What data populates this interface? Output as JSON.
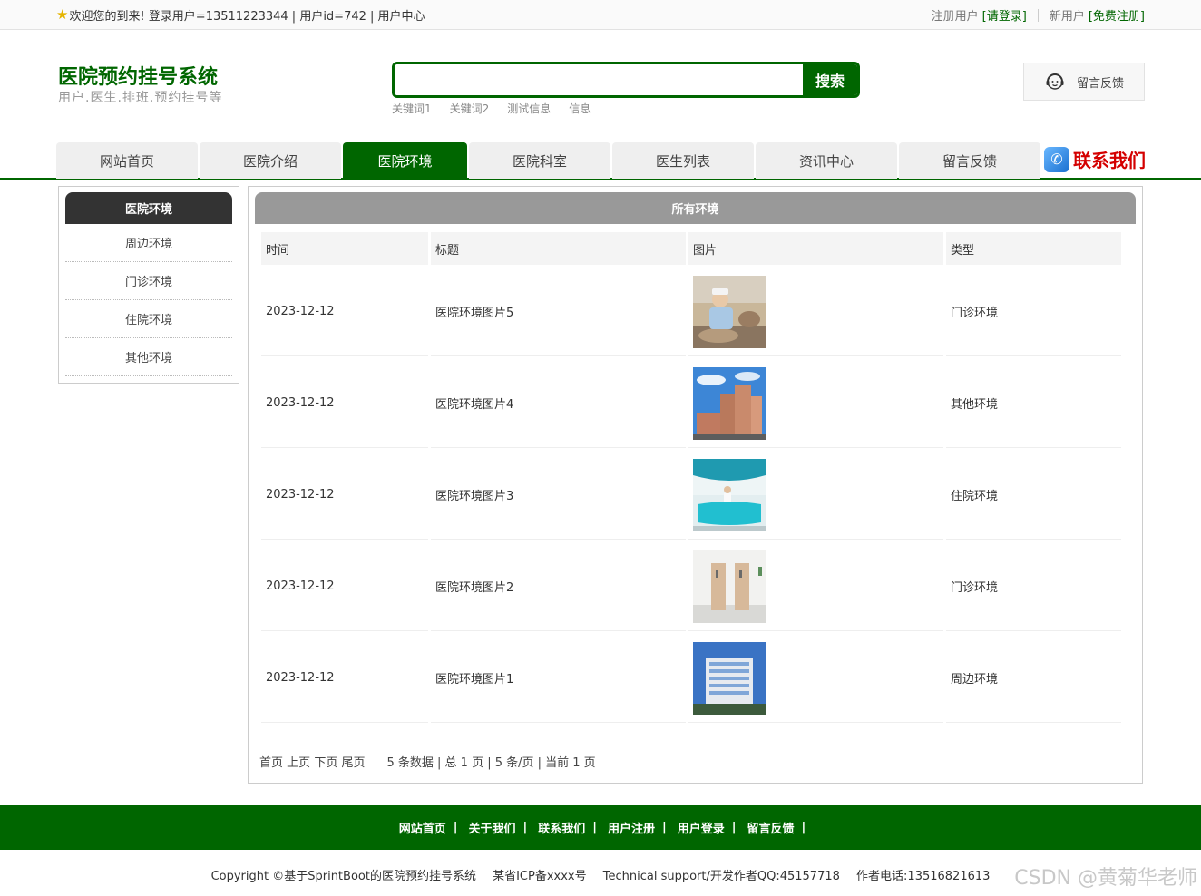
{
  "topbar": {
    "welcome": "欢迎您的到来!  登录用户=13511223344 | 用户id=742 | 用户中心",
    "registered_label": "注册用户",
    "login_link": "[请登录]",
    "new_user_label": "新用户",
    "register_link": "[免费注册]"
  },
  "header": {
    "title": "医院预约挂号系统",
    "subtitle": "用户.医生.排班.预约挂号等",
    "search_placeholder": "",
    "search_button": "搜索",
    "keywords": [
      "关键词1",
      "关键词2",
      "测试信息",
      "信息"
    ],
    "feedback_button": "留言反馈"
  },
  "nav": {
    "items": [
      "网站首页",
      "医院介绍",
      "医院环境",
      "医院科室",
      "医生列表",
      "资讯中心",
      "留言反馈"
    ],
    "active_index": 2,
    "contact": "联系我们"
  },
  "sidebar": {
    "title": "医院环境",
    "items": [
      "周边环境",
      "门诊环境",
      "住院环境",
      "其他环境"
    ]
  },
  "main": {
    "title": "所有环境",
    "columns": [
      "时间",
      "标题",
      "图片",
      "类型"
    ],
    "rows": [
      {
        "time": "2023-12-12",
        "title": "医院环境图片5",
        "type": "门诊环境",
        "image": "nurse-photo"
      },
      {
        "time": "2023-12-12",
        "title": "医院环境图片4",
        "type": "其他环境",
        "image": "building-sky-photo"
      },
      {
        "time": "2023-12-12",
        "title": "医院环境图片3",
        "type": "住院环境",
        "image": "reception-desk-photo"
      },
      {
        "time": "2023-12-12",
        "title": "医院环境图片2",
        "type": "门诊环境",
        "image": "doors-photo"
      },
      {
        "time": "2023-12-12",
        "title": "医院环境图片1",
        "type": "周边环境",
        "image": "hospital-building-photo"
      }
    ],
    "pager": {
      "first": "首页",
      "prev": "上页",
      "next": "下页",
      "last": "尾页",
      "summary": "5 条数据 | 总 1 页 | 5 条/页 | 当前 1 页"
    }
  },
  "footer": {
    "links": [
      "网站首页",
      "关于我们",
      "联系我们",
      "用户注册",
      "用户登录",
      "留言反馈"
    ],
    "copyright": "Copyright ©基于SprintBoot的医院预约挂号系统",
    "icp": "某省ICP备xxxx号",
    "support": "Technical support/开发作者QQ:45157718",
    "phone": "作者电话:13516821613",
    "watermark": "CSDN @黄菊华老师"
  },
  "colors": {
    "brand_green": "#006600",
    "sidebar_head": "#333333",
    "main_head": "#999999",
    "contact_red": "#d40000"
  }
}
